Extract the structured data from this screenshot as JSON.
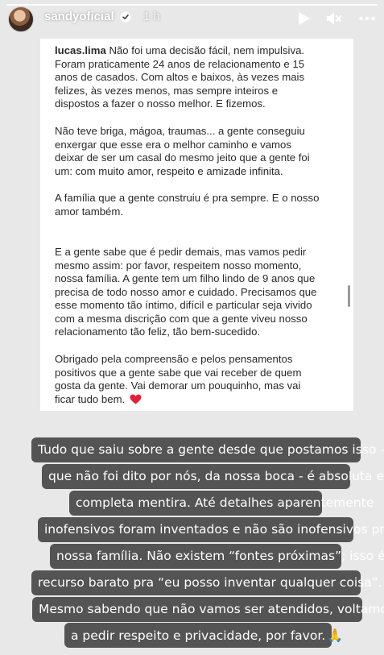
{
  "header": {
    "username": "sandyoficial",
    "time": "1 h",
    "icons": [
      "verified-badge-icon",
      "play-icon",
      "mute-icon",
      "more-icon"
    ]
  },
  "note": {
    "author": "lucas.lima",
    "p1_rest": "Não foi uma decisão fácil, nem impulsiva.",
    "p1_lines": [
      "Foram praticamente 24 anos de relacionamento e 15",
      "anos de casados. Com altos e baixos, às vezes mais",
      "felizes, às vezes menos, mas sempre inteiros e",
      "dispostos a fazer o nosso melhor. E fizemos."
    ],
    "p2_lines": [
      "Não teve briga, mágoa, traumas... a gente conseguiu",
      "enxergar que esse era o melhor caminho e vamos",
      "deixar de ser um casal do mesmo jeito que a gente foi",
      "um: com muito amor, respeito e amizade infinita."
    ],
    "p3_lines": [
      "A família que a gente construiu é pra sempre. E o nosso",
      "amor também."
    ],
    "p4_lines": [
      "E a gente sabe que é pedir demais, mas vamos pedir",
      "mesmo assim: por favor, respeitem nosso momento,",
      "nossa família. A gente tem um filho lindo de 9 anos que",
      "precisa de todo nosso amor e cuidado. Precisamos que",
      "esse momento tão íntimo, difícil e particular seja vivido",
      "com a mesma discrição com que a gente viveu nosso",
      "relacionamento tão feliz, tão bem-sucedido."
    ],
    "p5_lines": [
      "Obrigado pela compreensão e pelos pensamentos",
      "positivos que a gente sabe que vai receber de quem",
      "gosta da gente. Vai demorar um pouquinho, mas vai",
      "ficar tudo bem."
    ],
    "heart_emoji": "❤️"
  },
  "caption1": [
    "Tudo que saiu sobre a gente desde que postamos isso - e",
    "que não foi dito por nós, da nossa boca - é absoluta e",
    "completa mentira. Até detalhes aparentemente",
    "inofensivos foram inventados e não são inofensivos pra",
    "nossa família. Não existem “fontes próximas”; isso é",
    "recurso barato pra “eu posso inventar qualquer coisa”."
  ],
  "caption2": [
    "Mesmo sabendo que não vamos ser atendidos, voltamos",
    "a pedir respeito e privacidade, por favor."
  ],
  "caption2_emoji": "🙏",
  "colors": {
    "story_background": "#e8e8e8",
    "card_background": "#ffffff",
    "caption_background": "#545454",
    "heart": "#e0213a"
  }
}
